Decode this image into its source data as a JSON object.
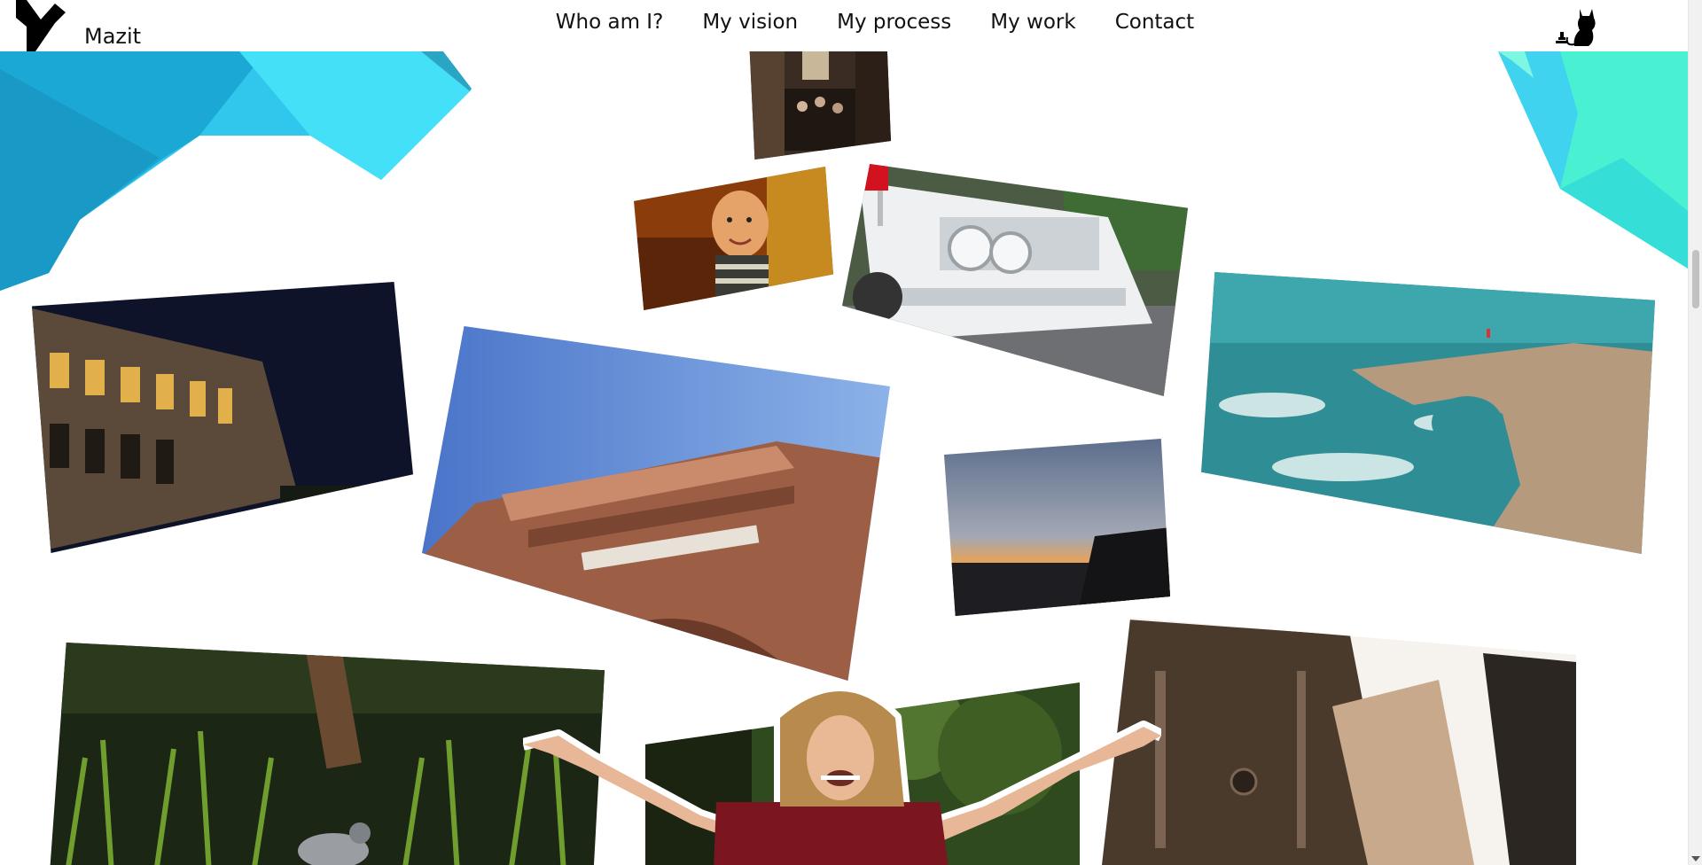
{
  "site": {
    "name": "Mazit",
    "logo_icon": "m-logo-icon",
    "mascot_icon": "cat-icon"
  },
  "nav": {
    "items": [
      {
        "label": "Who am I?"
      },
      {
        "label": "My vision"
      },
      {
        "label": "My process"
      },
      {
        "label": "My work"
      },
      {
        "label": "Contact"
      }
    ]
  },
  "gallery": {
    "photos": [
      "street-crowd",
      "baby",
      "white-vintage-car",
      "colosseum-night",
      "brick-building-facade",
      "sunset-sea",
      "sea-arch-rock",
      "pigeon-grass",
      "forest",
      "gothic-street"
    ]
  },
  "colors": {
    "accent_cyan": "#3fd8f2",
    "accent_blue": "#1ba1c8",
    "accent_mint": "#4af0d2",
    "text": "#111111"
  }
}
